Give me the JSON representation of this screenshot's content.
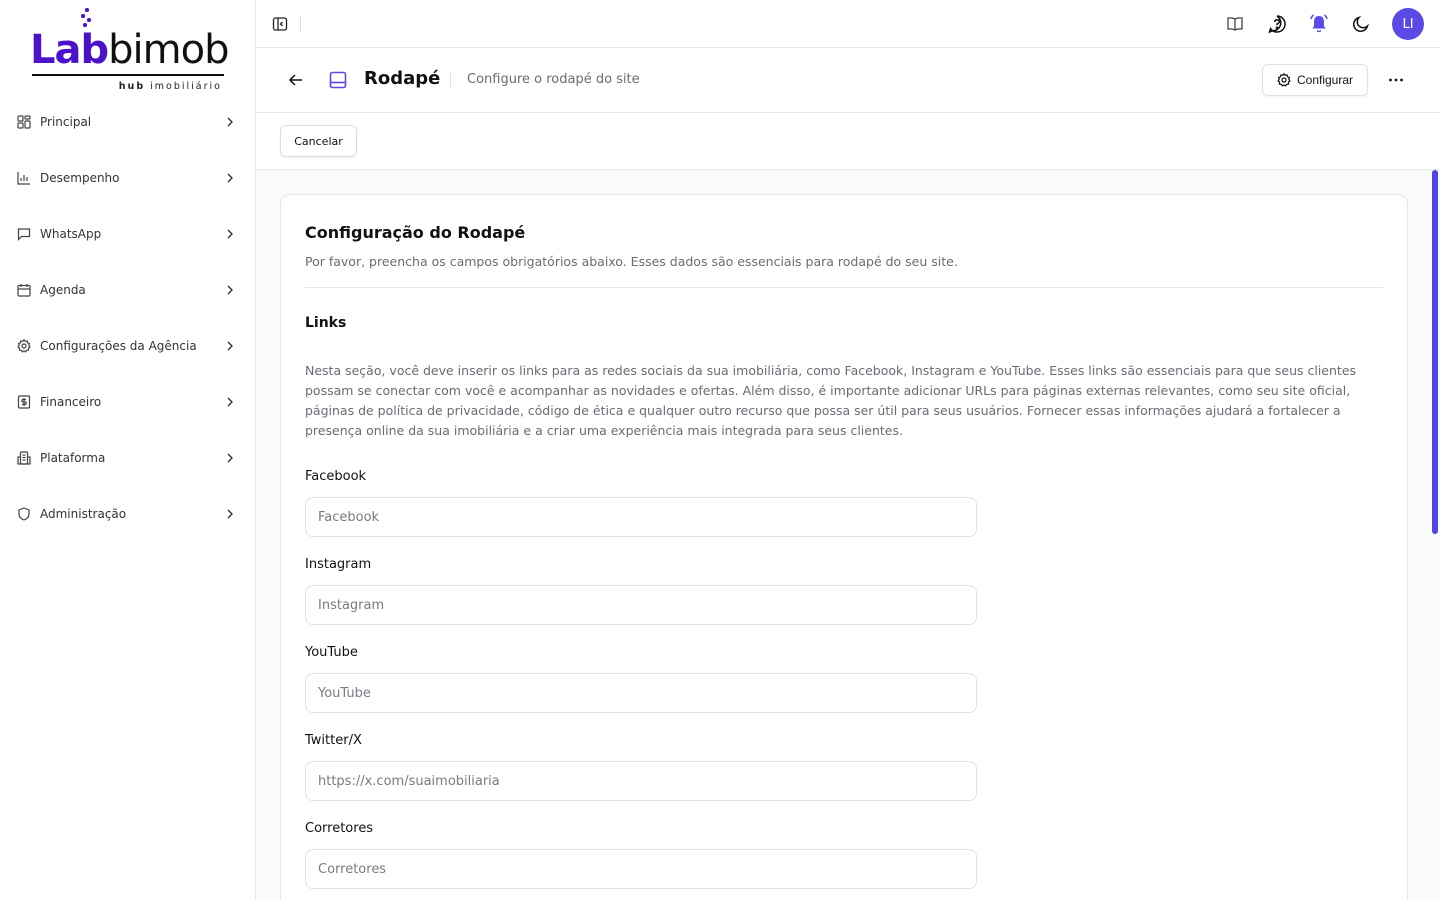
{
  "brand": {
    "name_part1": "Lab",
    "name_part2": "imob",
    "tagline_bold": "hub",
    "tagline": "imobiliário",
    "color": "#4b12c9"
  },
  "sidebar": {
    "items": [
      {
        "label": "Principal",
        "icon": "grid-icon"
      },
      {
        "label": "Desempenho",
        "icon": "bar-chart-icon"
      },
      {
        "label": "WhatsApp",
        "icon": "message-icon"
      },
      {
        "label": "Agenda",
        "icon": "calendar-icon"
      },
      {
        "label": "Configurações da Agência",
        "icon": "gear-icon"
      },
      {
        "label": "Financeiro",
        "icon": "dollar-icon"
      },
      {
        "label": "Plataforma",
        "icon": "building-icon"
      },
      {
        "label": "Administração",
        "icon": "shield-icon"
      }
    ]
  },
  "topbar": {
    "avatar_initials": "LI",
    "avatar_color": "#5b4ae6",
    "bell_color": "#5b4ae6"
  },
  "header": {
    "title": "Rodapé",
    "subtitle": "Configure o rodapé do site",
    "configure_label": "Configurar"
  },
  "actions": {
    "cancel_label": "Cancelar"
  },
  "card": {
    "title": "Configuração do Rodapé",
    "description": "Por favor, preencha os campos obrigatórios abaixo. Esses dados são essenciais para rodapé do seu site.",
    "section_title": "Links",
    "section_text": "Nesta seção, você deve inserir os links para as redes sociais da sua imobiliária, como Facebook, Instagram e YouTube. Esses links são essenciais para que seus clientes possam se conectar com você e acompanhar as novidades e ofertas. Além disso, é importante adicionar URLs para páginas externas relevantes, como seu site oficial, páginas de política de privacidade, código de ética e qualquer outro recurso que possa ser útil para seus usuários. Fornecer essas informações ajudará a fortalecer a presença online da sua imobiliária e a criar uma experiência mais integrada para seus clientes.",
    "fields": [
      {
        "label": "Facebook",
        "placeholder": "Facebook",
        "value": ""
      },
      {
        "label": "Instagram",
        "placeholder": "Instagram",
        "value": ""
      },
      {
        "label": "YouTube",
        "placeholder": "YouTube",
        "value": ""
      },
      {
        "label": "Twitter/X",
        "placeholder": "https://x.com/suaimobiliaria",
        "value": ""
      },
      {
        "label": "Corretores",
        "placeholder": "Corretores",
        "value": ""
      }
    ]
  }
}
